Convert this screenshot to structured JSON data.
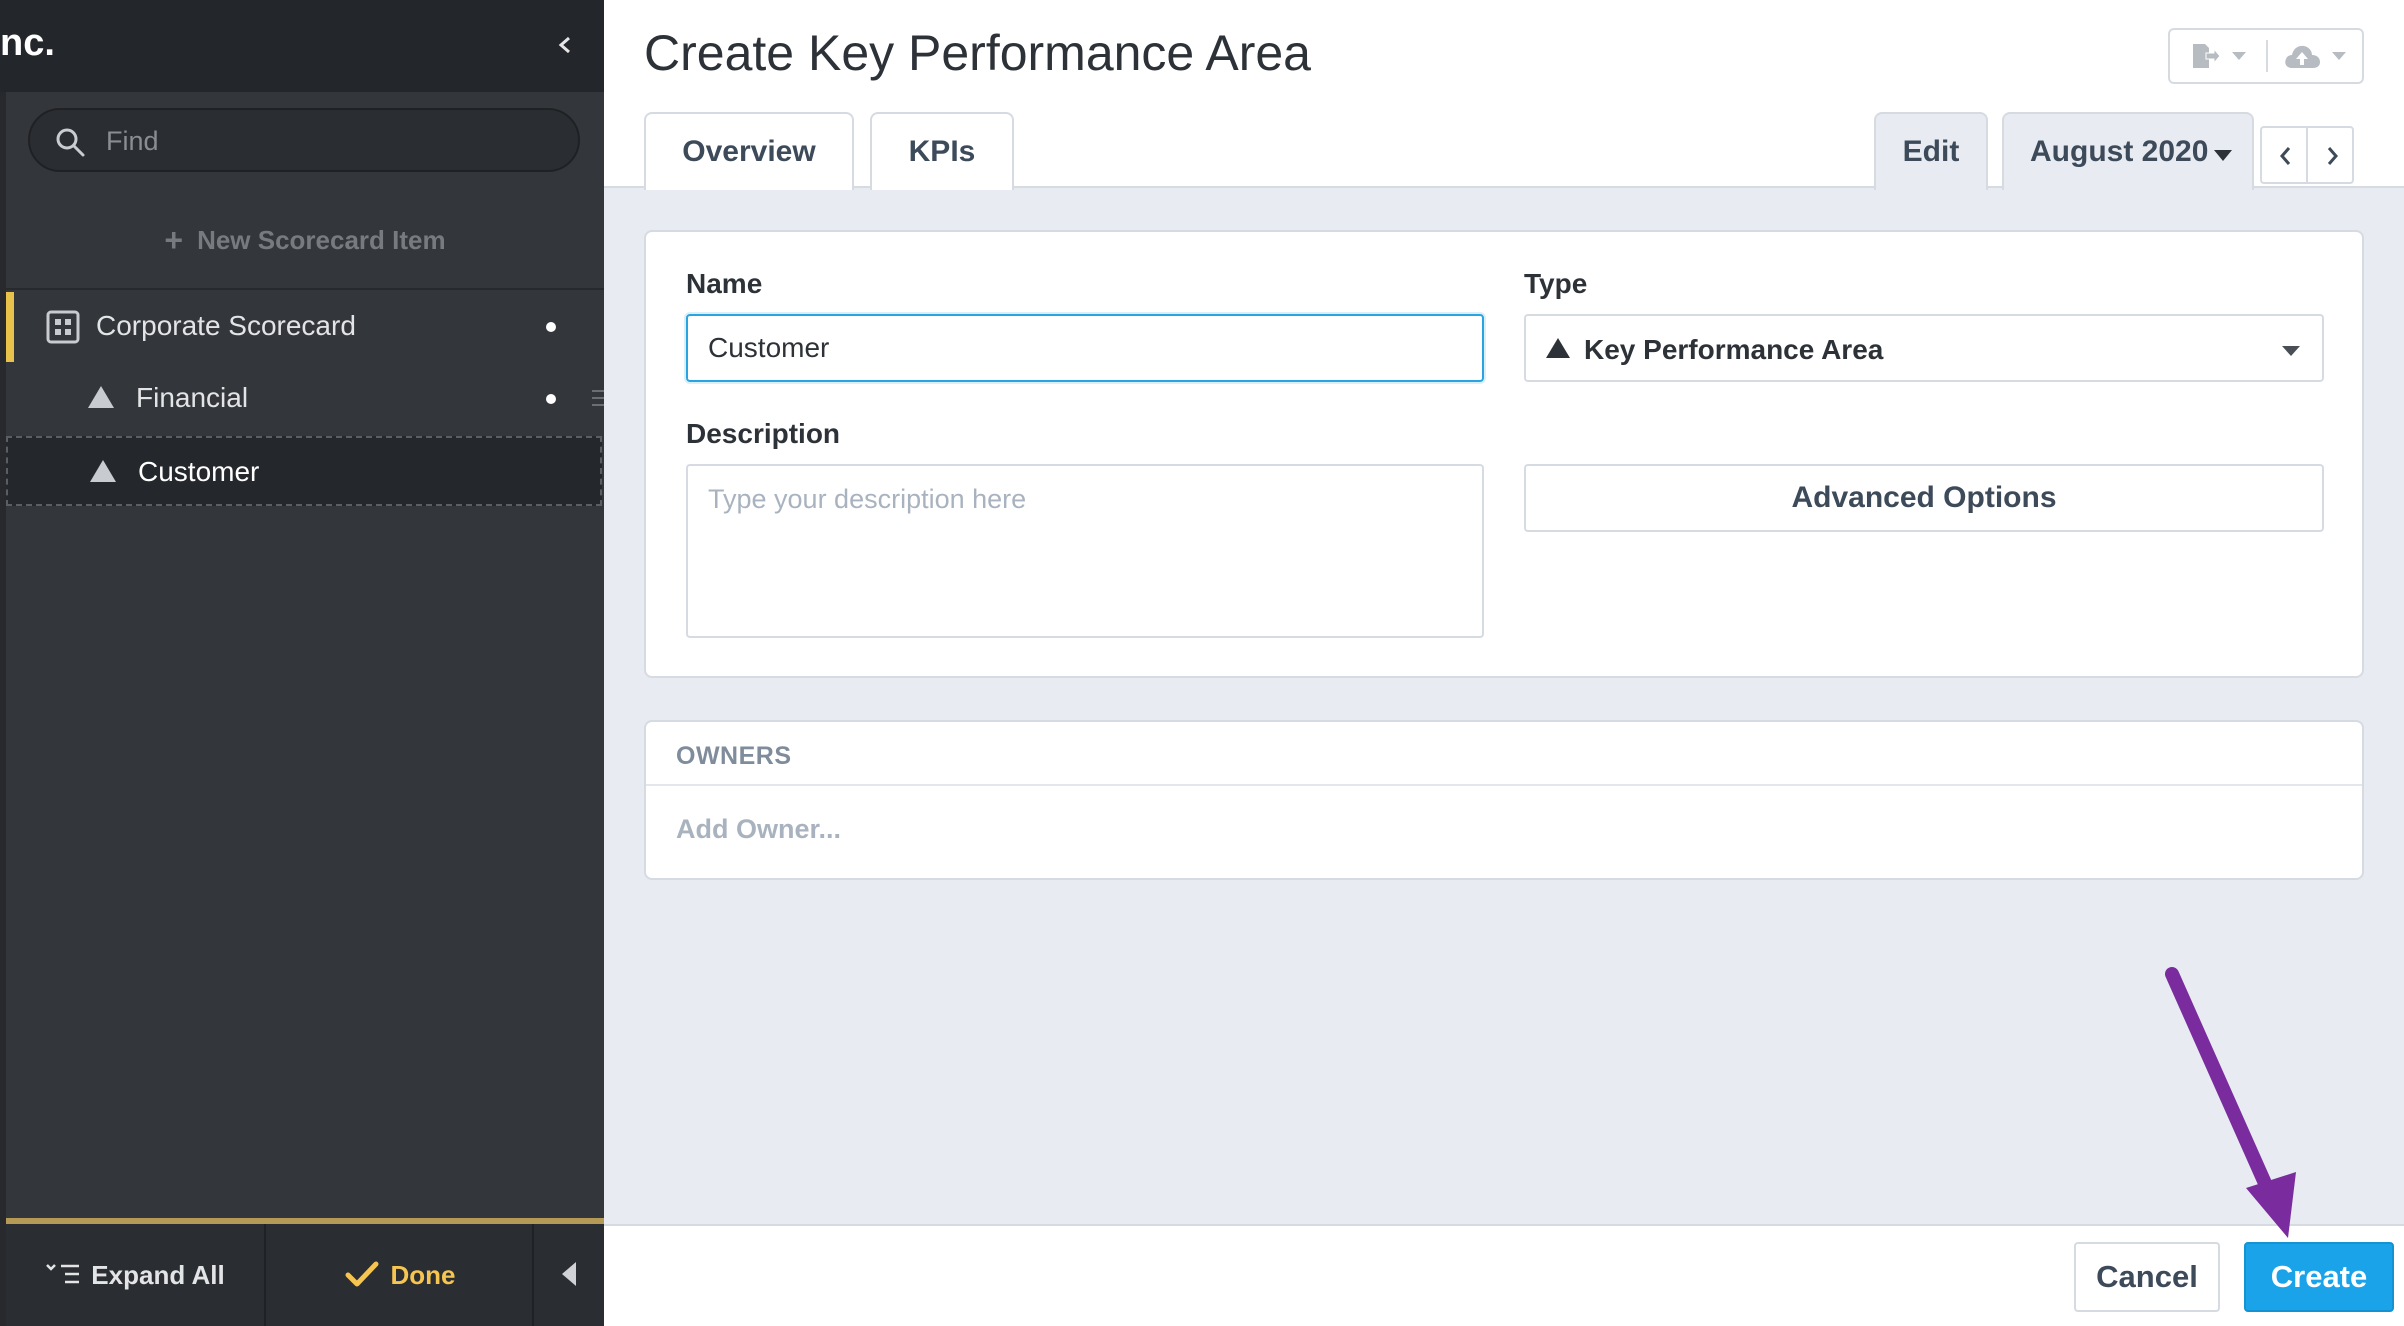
{
  "sidebar": {
    "org_name": "nc.",
    "search": {
      "placeholder": "Find",
      "value": ""
    },
    "new_item_label": "New Scorecard Item",
    "items": [
      {
        "label": "Corporate Scorecard",
        "icon": "scorecard-icon"
      },
      {
        "label": "Financial",
        "icon": "triangle-icon"
      },
      {
        "label": "Customer",
        "icon": "triangle-icon"
      }
    ],
    "footer": {
      "expand_all_label": "Expand All",
      "done_label": "Done"
    },
    "accent_color": "#e8c24a"
  },
  "header": {
    "title": "Create Key Performance Area",
    "tabs": [
      {
        "label": "Overview"
      },
      {
        "label": "KPIs"
      }
    ],
    "edit_tab_label": "Edit",
    "period": "August 2020"
  },
  "form": {
    "name_label": "Name",
    "name_value": "Customer",
    "type_label": "Type",
    "type_value": "Key Performance Area",
    "description_label": "Description",
    "description_placeholder": "Type your description here",
    "advanced_options_label": "Advanced Options"
  },
  "owners": {
    "title": "OWNERS",
    "add_placeholder": "Add Owner..."
  },
  "footer": {
    "cancel_label": "Cancel",
    "create_label": "Create"
  },
  "colors": {
    "primary": "#1aa3e8",
    "annotation": "#7a2b9e"
  }
}
